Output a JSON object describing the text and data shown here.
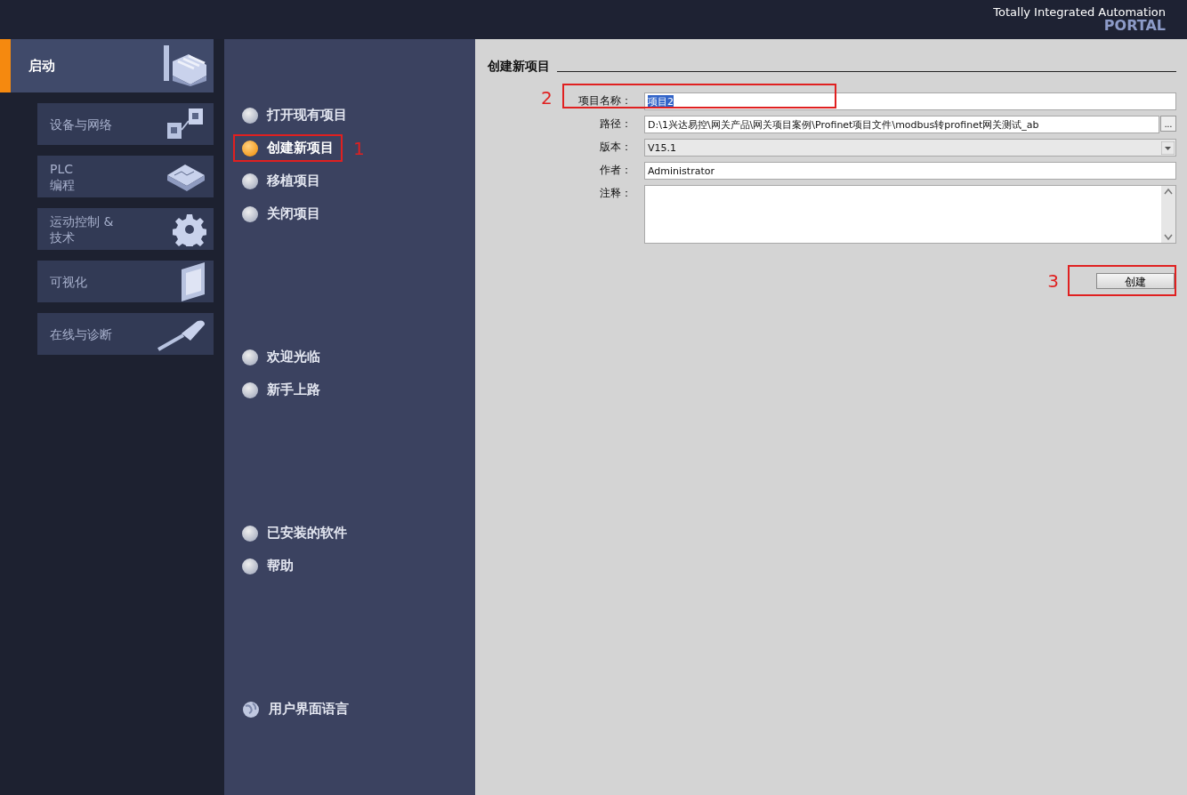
{
  "header": {
    "title": "Totally Integrated Automation",
    "subtitle": "PORTAL"
  },
  "sidebar": {
    "main": {
      "label": "启动",
      "selected": true
    },
    "items": [
      {
        "label": "设备与网络",
        "selected": false
      },
      {
        "label": "PLC\n编程",
        "selected": false
      },
      {
        "label": "运动控制 &\n技术",
        "selected": false
      },
      {
        "label": "可视化",
        "selected": false
      },
      {
        "label": "在线与诊断",
        "selected": false
      }
    ]
  },
  "menu": {
    "groups": [
      {
        "items": [
          {
            "label": "打开现有项目",
            "selected": false,
            "kind": "bullet"
          },
          {
            "label": "创建新项目",
            "selected": true,
            "kind": "bullet",
            "annotation": "1"
          },
          {
            "label": "移植项目",
            "selected": false,
            "kind": "bullet"
          },
          {
            "label": "关闭项目",
            "selected": false,
            "kind": "bullet"
          }
        ]
      },
      {
        "items": [
          {
            "label": "欢迎光临",
            "selected": false,
            "kind": "bullet"
          },
          {
            "label": "新手上路",
            "selected": false,
            "kind": "bullet"
          }
        ]
      },
      {
        "items": [
          {
            "label": "已安装的软件",
            "selected": false,
            "kind": "bullet"
          },
          {
            "label": "帮助",
            "selected": false,
            "kind": "bullet"
          }
        ]
      },
      {
        "items": [
          {
            "label": "用户界面语言",
            "selected": false,
            "kind": "globe"
          }
        ]
      }
    ]
  },
  "form": {
    "title": "创建新项目",
    "fields": [
      {
        "label": "项目名称：",
        "value": "项目2",
        "kind": "text",
        "highlighted": true,
        "annotation": "2"
      },
      {
        "label": "路径：",
        "value": "D:\\1兴达易控\\网关产品\\网关项目案例\\Profinet项目文件\\modbus转profinet网关测试_ab",
        "kind": "browse",
        "browse_label": "..."
      },
      {
        "label": "版本：",
        "value": "V15.1",
        "kind": "select"
      },
      {
        "label": "作者：",
        "value": "Administrator",
        "kind": "text",
        "highlighted": false
      },
      {
        "label": "注释：",
        "kind": "textarea"
      }
    ],
    "button": {
      "label": "创建",
      "annotation": "3"
    }
  }
}
